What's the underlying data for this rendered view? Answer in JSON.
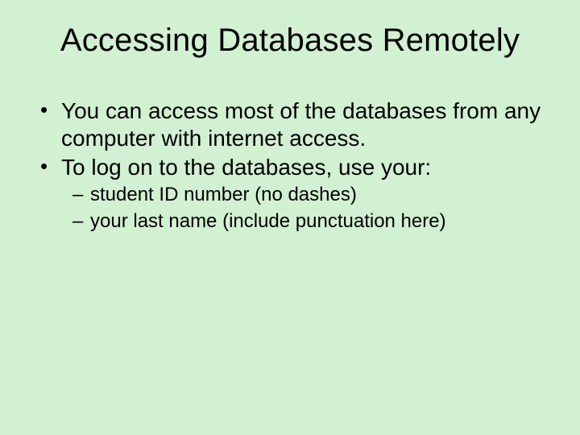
{
  "title": "Accessing Databases Remotely",
  "bullets": [
    {
      "text": "You can access most of the databases from any computer with internet access."
    },
    {
      "text": "To log on to the databases, use your:",
      "sub": [
        "student ID number (no dashes)",
        "your last name (include punctuation here)"
      ]
    }
  ]
}
